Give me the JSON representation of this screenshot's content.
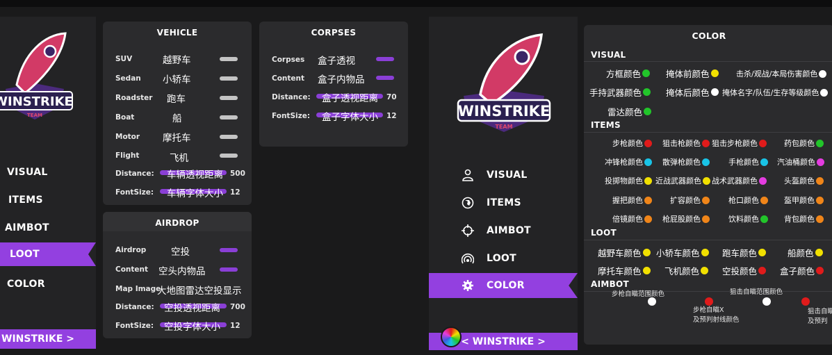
{
  "left_app": {
    "nav": [
      {
        "label": "VISUAL",
        "active": false
      },
      {
        "label": "ITEMS",
        "active": false
      },
      {
        "label": "AIMBOT",
        "active": false
      },
      {
        "label": "LOOT",
        "active": true
      },
      {
        "label": "COLOR",
        "active": false
      }
    ],
    "footer": "WINSTRIKE >",
    "vehicle": {
      "title": "VEHICLE",
      "rows": [
        {
          "en": "SUV",
          "cn": "越野车"
        },
        {
          "en": "Sedan",
          "cn": "小轿车"
        },
        {
          "en": "Roadster",
          "cn": "跑车"
        },
        {
          "en": "Boat",
          "cn": "船"
        },
        {
          "en": "Motor",
          "cn": "摩托车"
        },
        {
          "en": "Flight",
          "cn": "飞机"
        }
      ],
      "distance": {
        "en": "Distance:",
        "cn": "车辆透视距离",
        "value": "500"
      },
      "fontsize": {
        "en": "FontSize:",
        "cn": "车辆字体大小",
        "value": "12"
      }
    },
    "airdrop": {
      "title": "AIRDROP",
      "rows": [
        {
          "en": "Airdrop",
          "cn": "空投"
        },
        {
          "en": "Content",
          "cn": "空头内物品"
        }
      ],
      "mapimage": {
        "en": "Map Image",
        "cn": "大地图雷达空投显示"
      },
      "distance": {
        "en": "Distance:",
        "cn": "空投透视距离",
        "value": "700"
      },
      "fontsize": {
        "en": "FontSize:",
        "cn": "空投字体大小",
        "value": "12"
      }
    },
    "corpses": {
      "title": "CORPSES",
      "rows": [
        {
          "en": "Corpses",
          "cn": "盒子透视"
        },
        {
          "en": "Content",
          "cn": "盒子内物品"
        }
      ],
      "distance": {
        "en": "Distance:",
        "cn": "盒子透视距离",
        "value": "70"
      },
      "fontsize": {
        "en": "FontSize:",
        "cn": "盒子字体大小",
        "value": "12"
      }
    }
  },
  "right_app": {
    "logo_text": "WINSTRIKE",
    "logo_sub": "TEAM",
    "nav": [
      {
        "label": "VISUAL",
        "icon": "user-icon",
        "active": false
      },
      {
        "label": "ITEMS",
        "icon": "globe-icon",
        "active": false
      },
      {
        "label": "AIMBOT",
        "icon": "crosshair-icon",
        "active": false
      },
      {
        "label": "LOOT",
        "icon": "signal-icon",
        "active": false
      },
      {
        "label": "COLOR",
        "icon": "gear-icon",
        "active": true
      }
    ],
    "footer": "< WINSTRIKE >",
    "color": {
      "title": "COLOR",
      "visual_head": "VISUAL",
      "visual": [
        {
          "label": "方框颜色",
          "color": "#22c52a"
        },
        {
          "label": "掩体前颜色",
          "color": "#f1e000"
        },
        {
          "label": "击杀/观战/本局伤害颜色",
          "color": "#ffffff"
        },
        {
          "label": "手持武器颜色",
          "color": "#22c52a"
        },
        {
          "label": "掩体后颜色",
          "color": "#ffffff"
        },
        {
          "label": "掩体名字/队伍/生存等级颜色",
          "color": "#ffffff"
        },
        {
          "label": "雷达颜色",
          "color": "#22c52a"
        }
      ],
      "items_head": "ITEMS",
      "items": [
        {
          "label": "步枪颜色",
          "color": "#e01b1b"
        },
        {
          "label": "狙击枪颜色",
          "color": "#e01b1b"
        },
        {
          "label": "狙击步枪颜色",
          "color": "#e01b1b"
        },
        {
          "label": "药包颜色",
          "color": "#22c52a"
        },
        {
          "label": "冲锋枪颜色",
          "color": "#19c3e6"
        },
        {
          "label": "散弹枪颜色",
          "color": "#19c3e6"
        },
        {
          "label": "手枪颜色",
          "color": "#19c3e6"
        },
        {
          "label": "汽油桶颜色",
          "color": "#e43ce0"
        },
        {
          "label": "投掷物颜色",
          "color": "#f1e000"
        },
        {
          "label": "近战武器颜色",
          "color": "#f1e000"
        },
        {
          "label": "战术武器颜色",
          "color": "#e43ce0"
        },
        {
          "label": "头盔颜色",
          "color": "#f08519"
        },
        {
          "label": "握把颜色",
          "color": "#f08519"
        },
        {
          "label": "扩容颜色",
          "color": "#f08519"
        },
        {
          "label": "枪口颜色",
          "color": "#f08519"
        },
        {
          "label": "盔甲颜色",
          "color": "#f08519"
        },
        {
          "label": "倍镜颜色",
          "color": "#f08519"
        },
        {
          "label": "枪屁股颜色",
          "color": "#f08519"
        },
        {
          "label": "饮料颜色",
          "color": "#22c52a"
        },
        {
          "label": "背包颜色",
          "color": "#f08519"
        }
      ],
      "loot_head": "LOOT",
      "loot": [
        {
          "label": "越野车颜色",
          "color": "#f1e000"
        },
        {
          "label": "小轿车颜色",
          "color": "#f1e000"
        },
        {
          "label": "跑车颜色",
          "color": "#f1e000"
        },
        {
          "label": "船颜色",
          "color": "#f1e000"
        },
        {
          "label": "摩托车颜色",
          "color": "#f1e000"
        },
        {
          "label": "飞机颜色",
          "color": "#f1e000"
        },
        {
          "label": "空投颜色",
          "color": "#e01b1b"
        },
        {
          "label": "盒子颜色",
          "color": "#e01b1b"
        }
      ],
      "aimbot_head": "AIMBOT",
      "aimbot": {
        "rifle_range": "步枪自瞄范围颜色",
        "sniper_range": "狙击自瞄范围颜色",
        "rifle_x_1": "步枪自瞄X",
        "rifle_x_2": "及预判射线颜色",
        "sniper_x_1": "狙击自瞄",
        "sniper_x_2": "及预判",
        "dot_white": "#ffffff",
        "dot_red": "#e01b1b"
      }
    }
  },
  "accent": "#9340e0"
}
